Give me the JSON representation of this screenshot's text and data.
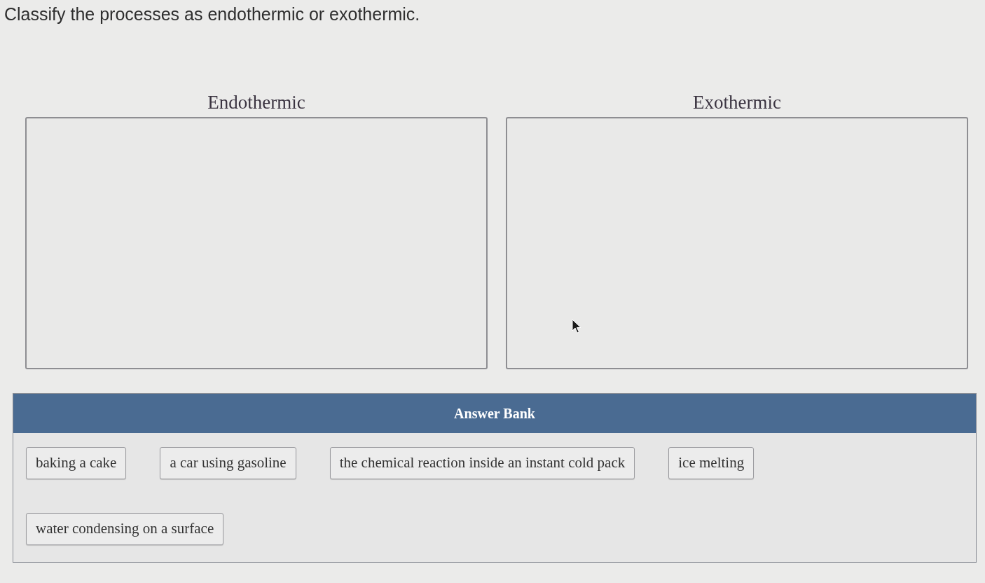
{
  "question": {
    "prompt": "Classify the processes as endothermic or exothermic."
  },
  "categories": [
    {
      "label": "Endothermic"
    },
    {
      "label": "Exothermic"
    }
  ],
  "answer_bank": {
    "title": "Answer Bank",
    "items": [
      "baking a cake",
      "a car using gasoline",
      "the chemical reaction inside an instant cold pack",
      "ice melting",
      "water condensing on a surface"
    ]
  }
}
